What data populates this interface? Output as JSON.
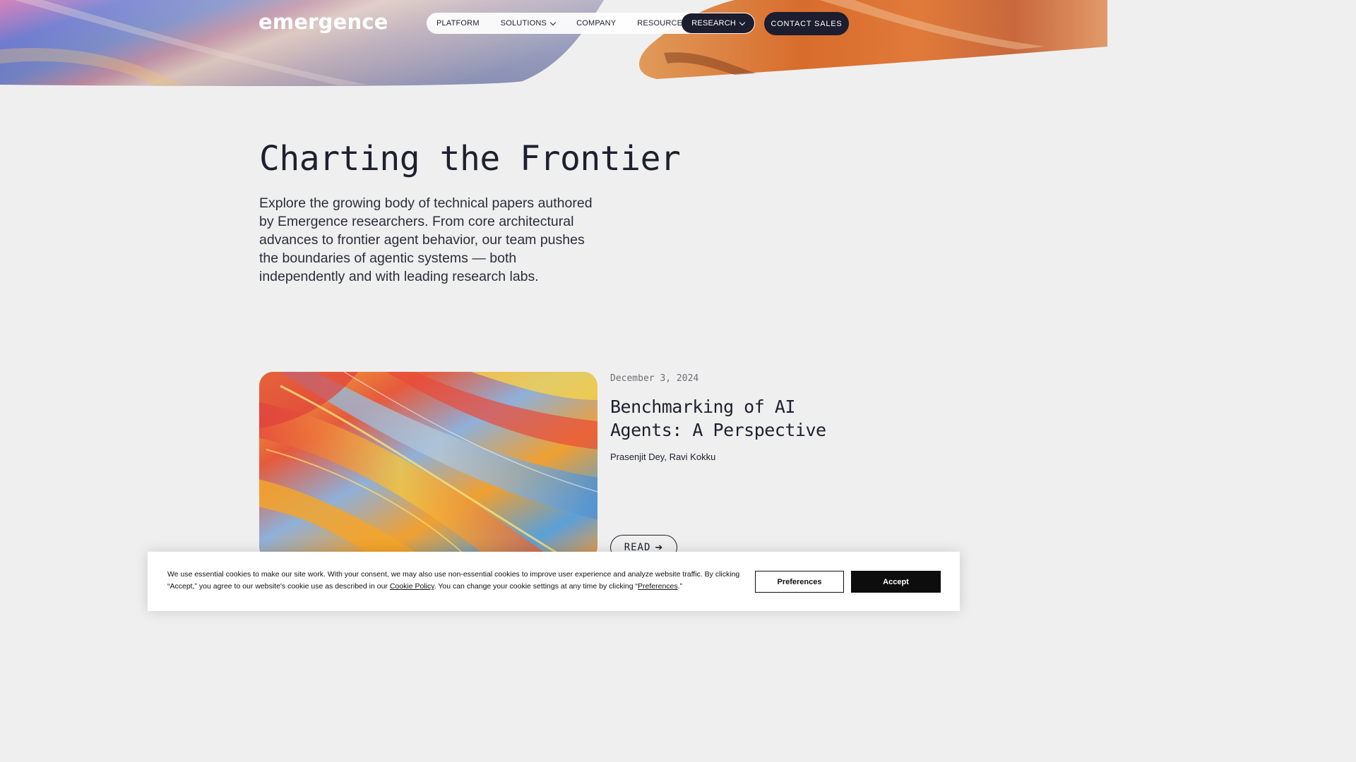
{
  "brand": {
    "logo_text": "emergence"
  },
  "nav": {
    "items": [
      {
        "label": "PLATFORM",
        "has_dropdown": false
      },
      {
        "label": "SOLUTIONS",
        "has_dropdown": true
      },
      {
        "label": "COMPANY",
        "has_dropdown": false
      },
      {
        "label": "RESOURCES",
        "has_dropdown": true
      },
      {
        "label": "RESEARCH",
        "has_dropdown": true,
        "active": true
      }
    ],
    "cta_label": "CONTACT SALES"
  },
  "hero": {
    "title": "Charting the Frontier",
    "intro": "Explore the growing body of technical papers authored by Emergence researchers. From core architectural advances to frontier agent behavior, our team pushes the boundaries of agentic systems — both independently and with leading research labs."
  },
  "featured_paper": {
    "date": "December 3, 2024",
    "title": "Benchmarking of AI Agents: A Perspective",
    "authors": "Prasenjit Dey, Ravi Kokku",
    "read_label": "READ",
    "read_icon": "arrow-right-icon",
    "image": "colorful-feathers-image"
  },
  "cookie_banner": {
    "text_part1": "We use essential cookies to make our site work. With your consent, we may also use non-essential cookies to improve user experience and analyze website traffic. By clicking “Accept,” you agree to our website's cookie use as described in our ",
    "policy_link": "Cookie Policy",
    "text_part2": ". You can change your cookie settings at any time by clicking “",
    "preferences_link": "Preferences",
    "text_part3": ".”",
    "preferences_button": "Preferences",
    "accept_button": "Accept"
  },
  "colors": {
    "background": "#efefef",
    "ink": "#1e2030",
    "nav_active": "#1c1d2e"
  }
}
